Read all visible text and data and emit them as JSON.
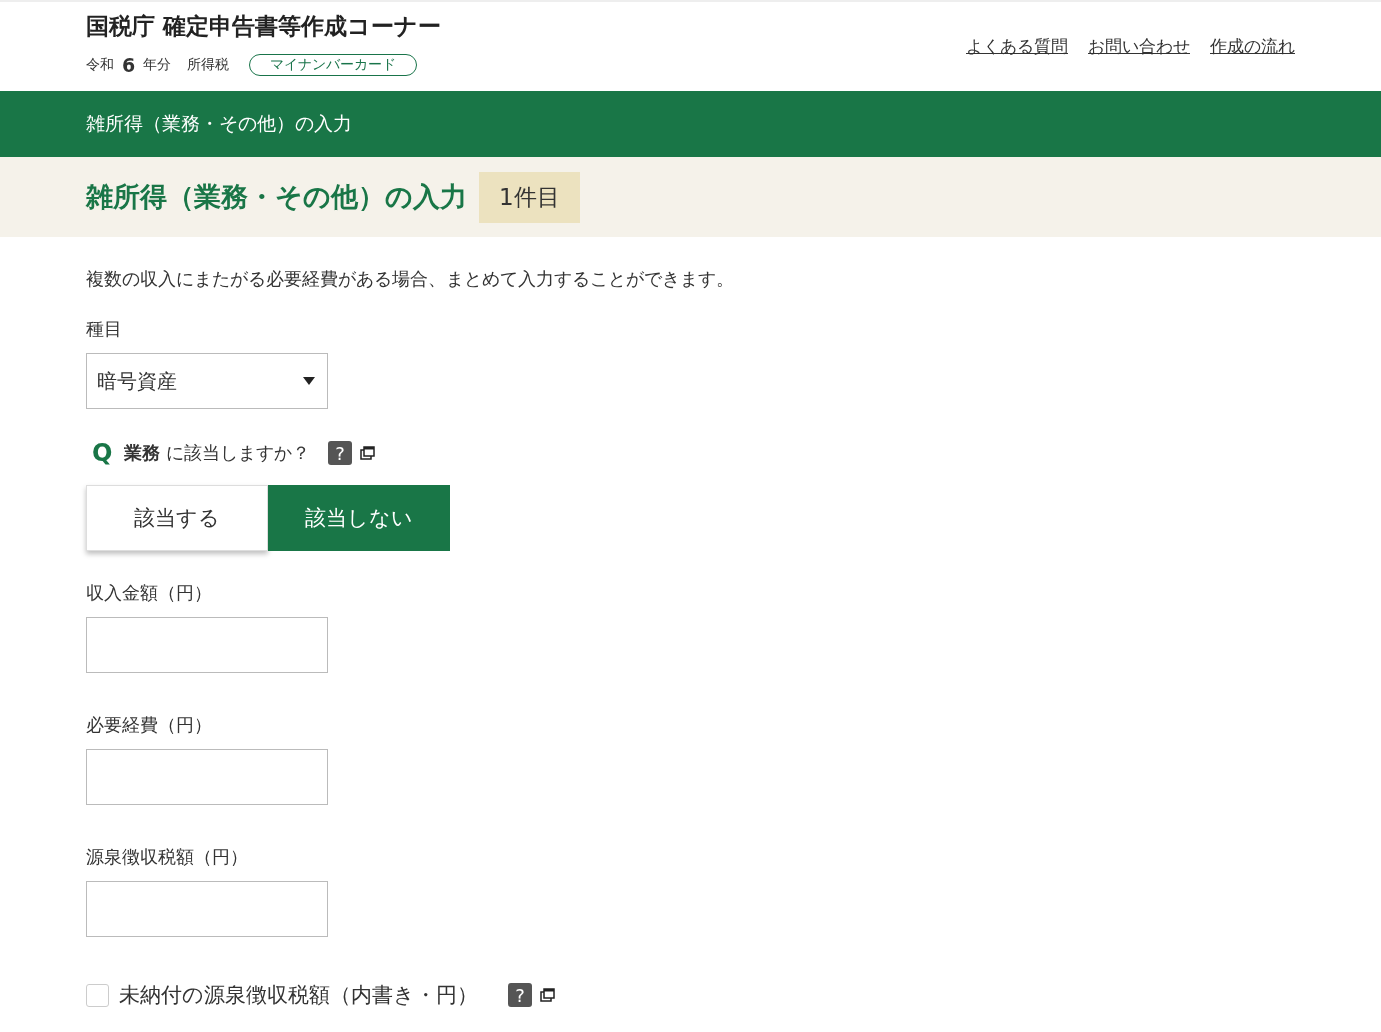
{
  "header": {
    "title": "国税庁 確定申告書等作成コーナー",
    "era": "令和",
    "year": "6",
    "year_suffix": "年分",
    "tax_type": "所得税",
    "badge": "マイナンバーカード",
    "links": [
      "よくある質問",
      "お問い合わせ",
      "作成の流れ"
    ]
  },
  "green_bar": {
    "title": "雑所得（業務・その他）の入力"
  },
  "page_heading": {
    "title": "雑所得（業務・その他）の入力",
    "count": "1件目"
  },
  "intro": "複数の収入にまたがる必要経費がある場合、まとめて入力することができます。",
  "category": {
    "label": "種目",
    "value": "暗号資産"
  },
  "question": {
    "mark": "Q",
    "text": "**業務** に該当しますか？",
    "help": "?",
    "options": [
      {
        "label": "該当する",
        "selected": false
      },
      {
        "label": "該当しない",
        "selected": true
      }
    ]
  },
  "fields": [
    {
      "label": "収入金額（円）"
    },
    {
      "label": "必要経費（円）"
    },
    {
      "label": "源泉徴収税額（円）"
    }
  ],
  "unpaid": {
    "label": "未納付の源泉徴収税額（内書き・円）",
    "checked": false,
    "help": "?"
  }
}
